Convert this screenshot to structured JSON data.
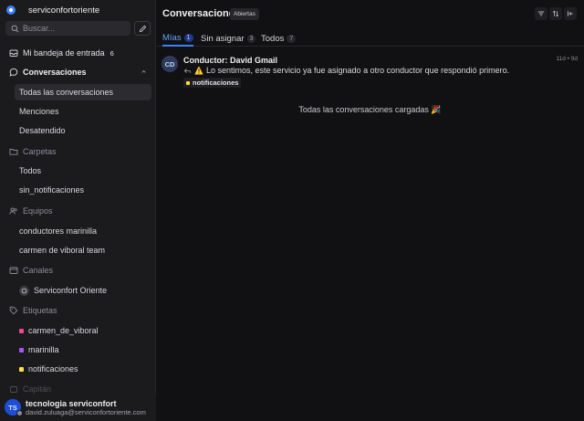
{
  "brand": {
    "name": "serviconfortoriente"
  },
  "search": {
    "placeholder": "Buscar..."
  },
  "sidebar": {
    "inbox": {
      "label": "Mi bandeja de entrada",
      "count": "6"
    },
    "conversations": {
      "label": "Conversaciones",
      "items": [
        "Todas las conversaciones",
        "Menciones",
        "Desatendido"
      ]
    },
    "folders": {
      "label": "Carpetas",
      "items": [
        "Todos",
        "sin_notificaciones"
      ]
    },
    "teams": {
      "label": "Equipos",
      "items": [
        "conductores marinilla",
        "carmen de viboral team"
      ]
    },
    "channels": {
      "label": "Canales",
      "items": [
        "Serviconfort Oriente"
      ]
    },
    "labels": {
      "label": "Etiquetas",
      "items": [
        {
          "name": "carmen_de_viboral",
          "color": "#ec4899"
        },
        {
          "name": "marinilla",
          "color": "#a855f7"
        },
        {
          "name": "notificaciones",
          "color": "#fde047"
        }
      ]
    },
    "captain": {
      "label": "Capitán"
    }
  },
  "user": {
    "initials": "TS",
    "name": "tecnologia serviconfort",
    "email": "david.zuluaga@serviconfortoriente.com"
  },
  "header": {
    "title": "Conversaciones",
    "status_badge": "Abiertas"
  },
  "tabs": [
    {
      "label": "Mías",
      "count": "1"
    },
    {
      "label": "Sin asignar",
      "count": "3"
    },
    {
      "label": "Todos",
      "count": "7"
    }
  ],
  "conversation": {
    "initials": "CD",
    "name": "Conductor: David Gmail",
    "time": "11d • 9d",
    "message": "Lo sentimos, este servicio ya fue asignado a otro conductor que respondió primero.",
    "label": "notificaciones"
  },
  "footer_note": "Todas las conversaciones cargadas 🎉",
  "colors": {
    "accent": "#3b82f6",
    "background": "#111113",
    "sidebar": "#1b1b1e"
  }
}
